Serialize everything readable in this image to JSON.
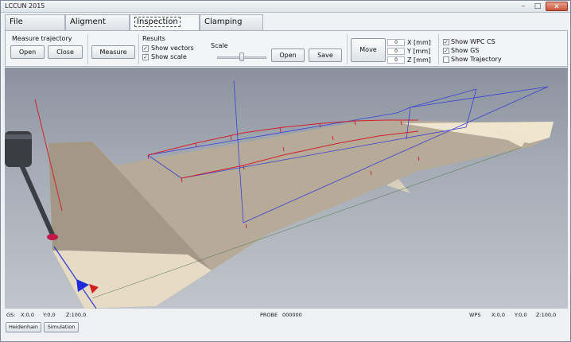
{
  "window": {
    "title": "LCCUN 2015",
    "minimize": "–",
    "maximize": "□",
    "close": "✕"
  },
  "tabs": [
    {
      "label": "File"
    },
    {
      "label": "Aligment"
    },
    {
      "label": "Inspection"
    },
    {
      "label": "Clamping"
    }
  ],
  "toolbar": {
    "measure_trajectory_label": "Measure trajectory",
    "open_label": "Open",
    "close_label": "Close",
    "measure_label": "Measure",
    "results_label": "Results",
    "show_vectors_label": "Show vectors",
    "show_vectors_checked": true,
    "show_scale_label": "Show scale",
    "show_scale_checked": true,
    "scale_label": "Scale",
    "scale_level_percent": 45,
    "scale_open_label": "Open",
    "scale_save_label": "Save",
    "move_label": "Move",
    "x_value": "0",
    "y_value": "0",
    "z_value": "0",
    "x_label": "X [mm]",
    "y_label": "Y [mm]",
    "z_label": "Z [mm]",
    "show_wpc_cs_label": "Show WPC CS",
    "show_wpc_cs_checked": true,
    "show_gs_label": "Show GS",
    "show_gs_checked": true,
    "show_trajectory_label": "Show Trajectory",
    "show_trajectory_checked": false
  },
  "status": {
    "gs_label": "GS:",
    "gs_x": "X:0,0",
    "gs_y": "Y:0,0",
    "gs_z": "Z:100,0",
    "probe_label": "PROBE",
    "probe_value": "000000",
    "wps_label": "WPS",
    "wps_x": "X:0,0",
    "wps_y": "Y:0,0",
    "wps_z": "Z:100,0"
  },
  "bottom_buttons": {
    "heidenhain": "Heidenhain",
    "simulation": "Simulation"
  },
  "colors": {
    "trajectory_red": "#d4202a",
    "frame_blue": "#3a3fd8",
    "surface": "#b8ad9a"
  }
}
